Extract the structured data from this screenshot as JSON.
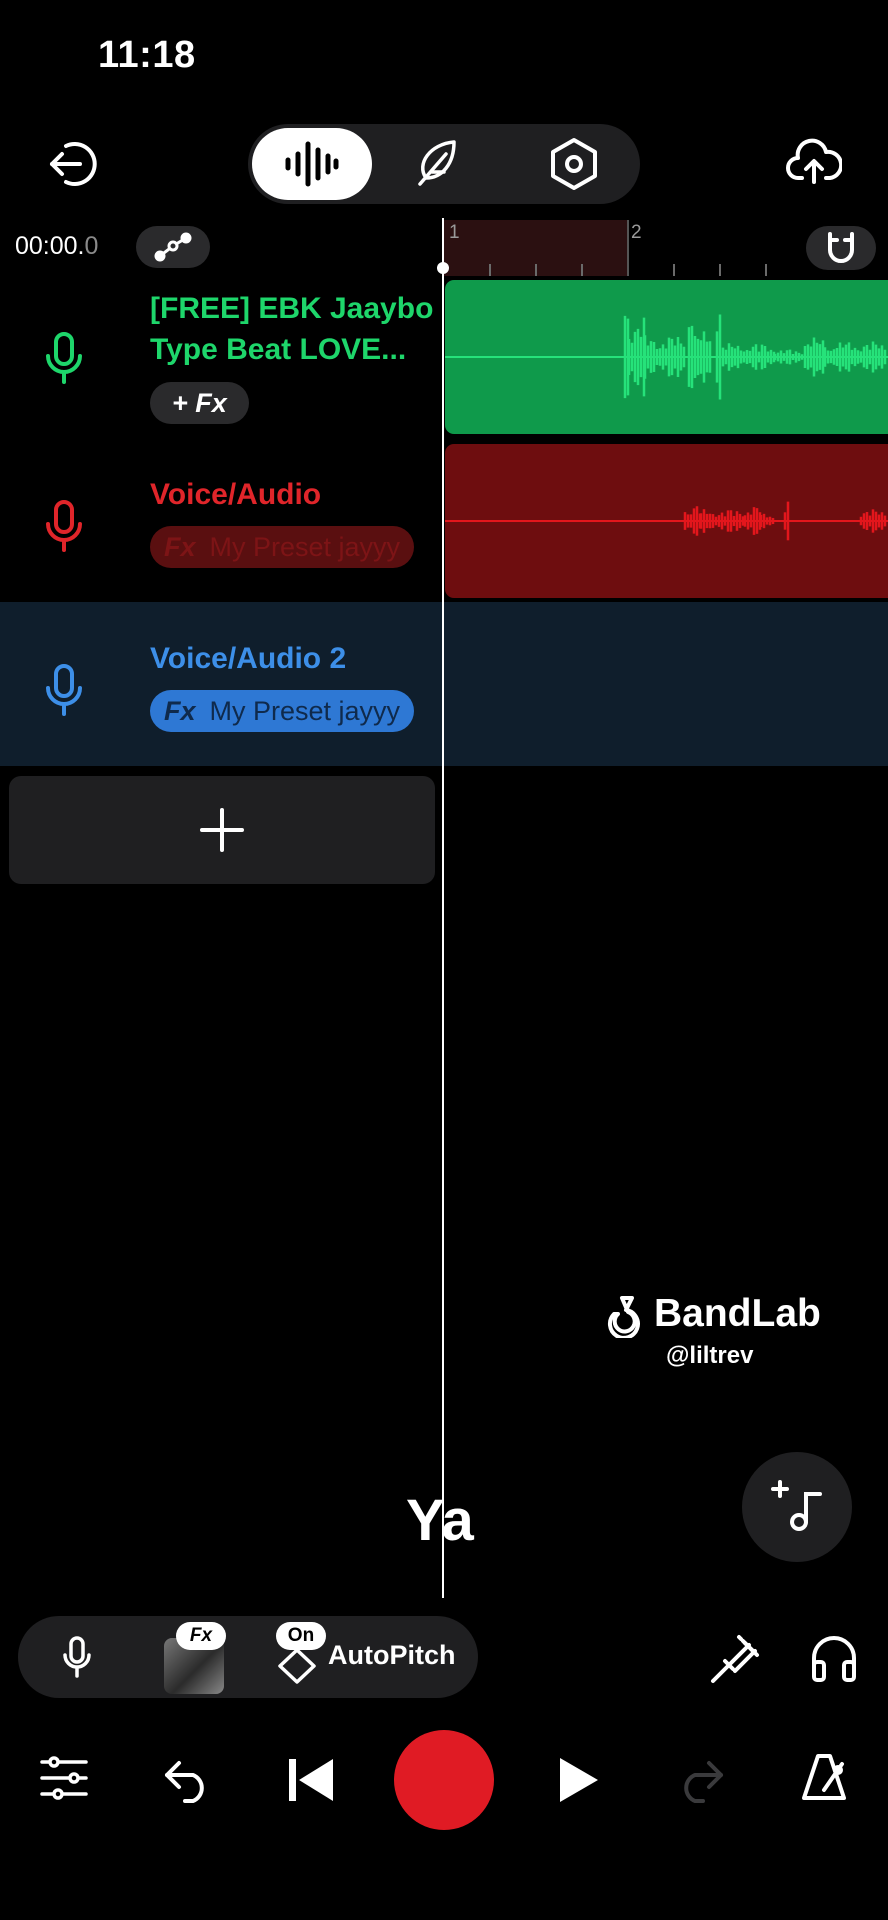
{
  "status_bar": {
    "time": "11:18"
  },
  "top_bar": {
    "icons": [
      "exit-icon",
      "waveform-icon",
      "feather-icon",
      "settings-icon",
      "cloud-upload-icon"
    ]
  },
  "timeline": {
    "time_main": "00:00.",
    "time_frac": "0",
    "ruler_marks": [
      "1",
      "2"
    ]
  },
  "tracks": [
    {
      "name_line1": "[FREE] EBK Jaaybo",
      "name_line2": "Type Beat  LOVE...",
      "fx_label": "+ Fx",
      "color": "#1ed66b",
      "clip_color": "#0f9a4b",
      "wave_color": "#26e27a"
    },
    {
      "name": "Voice/Audio",
      "fx_tag": "Fx",
      "fx_preset": "My Preset jayyy",
      "color": "#e0252a",
      "pill_bg": "#5a0f10",
      "pill_text": "#7d1416",
      "clip_color": "#6e0d0f",
      "wave_color": "#e3161c"
    },
    {
      "name": "Voice/Audio 2",
      "fx_tag": "Fx",
      "fx_preset": "My Preset jayyy",
      "color": "#3d8fe8",
      "pill_bg": "#2e78d4",
      "pill_text": "#0f2a4c"
    }
  ],
  "watermark": {
    "brand": "BandLab",
    "handle": "@liltrev"
  },
  "lyric_overlay": "Ya",
  "tool_bar": {
    "fx_badge": "Fx",
    "autopitch_badge": "On",
    "autopitch_label": "AutoPitch"
  },
  "colors": {
    "accent_record": "#e01b24",
    "panel": "#1f1f21"
  }
}
